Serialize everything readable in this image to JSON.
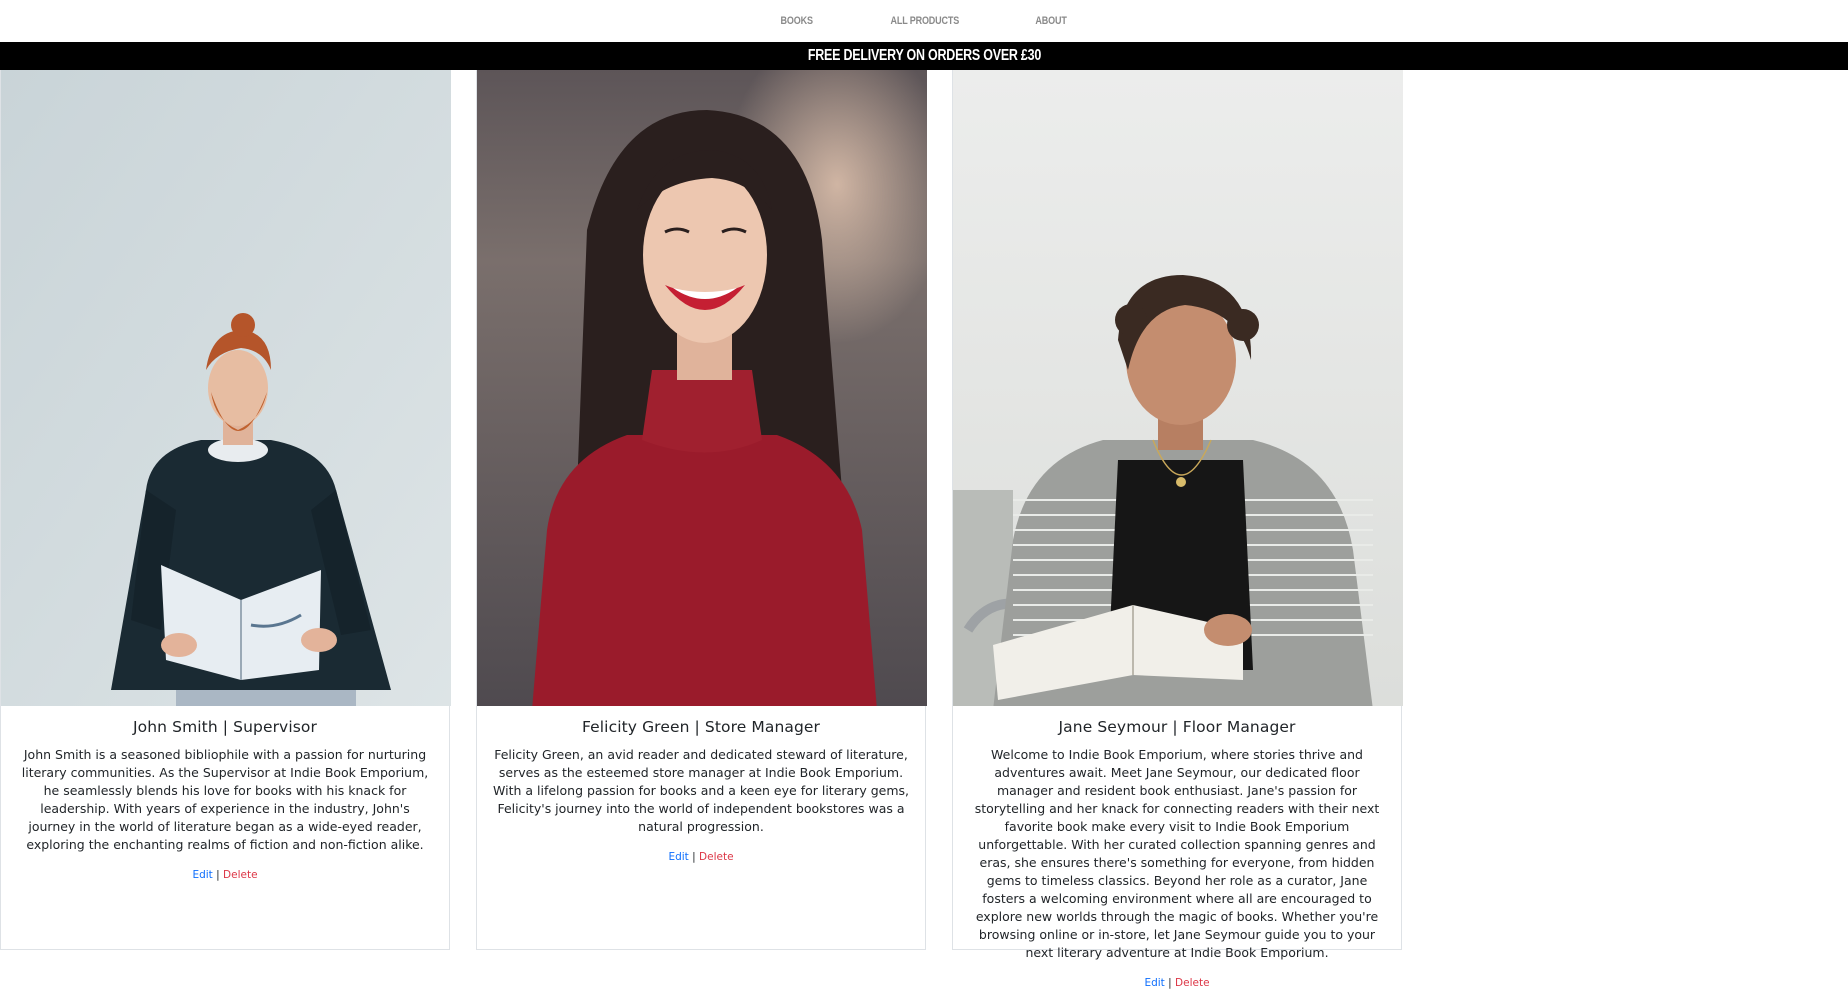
{
  "nav": {
    "items": [
      {
        "label": "BOOKS"
      },
      {
        "label": "ALL PRODUCTS"
      },
      {
        "label": "ABOUT"
      }
    ]
  },
  "banner": {
    "text": "FREE DELIVERY ON ORDERS OVER £30"
  },
  "staff": [
    {
      "title": "John Smith | Supervisor",
      "description": "John Smith is a seasoned bibliophile with a passion for nurturing literary communities. As the Supervisor at Indie Book Emporium, he seamlessly blends his love for books with his knack for leadership. With years of experience in the industry, John's journey in the world of literature began as a wide-eyed reader, exploring the enchanting realms of fiction and non-fiction alike.",
      "edit_label": "Edit",
      "separator": "|",
      "delete_label": "Delete"
    },
    {
      "title": "Felicity Green | Store Manager",
      "description": "Felicity Green, an avid reader and dedicated steward of literature, serves as the esteemed store manager at Indie Book Emporium. With a lifelong passion for books and a keen eye for literary gems, Felicity's journey into the world of independent bookstores was a natural progression.",
      "edit_label": "Edit",
      "separator": "|",
      "delete_label": "Delete"
    },
    {
      "title": "Jane Seymour | Floor Manager",
      "description": "Welcome to Indie Book Emporium, where stories thrive and adventures await. Meet Jane Seymour, our dedicated floor manager and resident book enthusiast. Jane's passion for storytelling and her knack for connecting readers with their next favorite book make every visit to Indie Book Emporium unforgettable. With her curated collection spanning genres and eras, she ensures there's something for everyone, from hidden gems to timeless classics. Beyond her role as a curator, Jane fosters a welcoming environment where all are encouraged to explore new worlds through the magic of books. Whether you're browsing online or in-store, let Jane Seymour guide you to your next literary adventure at Indie Book Emporium.",
      "edit_label": "Edit",
      "separator": "|",
      "delete_label": "Delete"
    }
  ],
  "photo_colors": {
    "card1_background": "#d3dcdf",
    "card2_background": "#6d6a6e",
    "card3_background": "#e7e8e6",
    "brand_banner": "#000000",
    "edit_link": "#0d6efd",
    "delete_link": "#dc3545"
  }
}
